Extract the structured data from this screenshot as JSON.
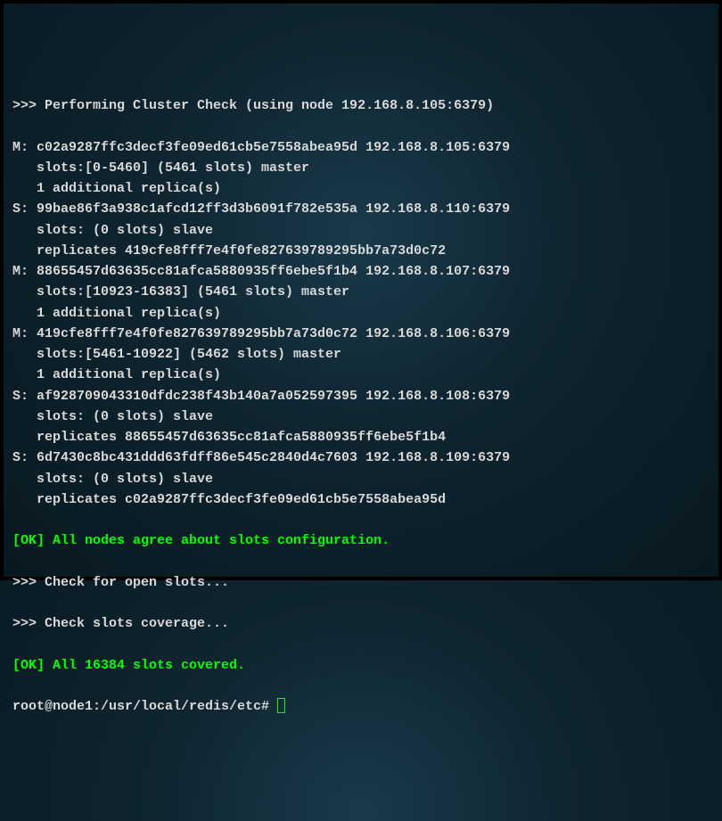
{
  "header": ">>> Performing Cluster Check (using node 192.168.8.105:6379)",
  "nodes": [
    {
      "role_prefix": "M: ",
      "id_addr": "c02a9287ffc3decf3fe09ed61cb5e7558abea95d 192.168.8.105:6379",
      "slots_line": "   slots:[0-5460] (5461 slots) master",
      "extra_line": "   1 additional replica(s)"
    },
    {
      "role_prefix": "S: ",
      "id_addr": "99bae86f3a938c1afcd12ff3d3b6091f782e535a 192.168.8.110:6379",
      "slots_line": "   slots: (0 slots) slave",
      "extra_line": "   replicates 419cfe8fff7e4f0fe827639789295bb7a73d0c72"
    },
    {
      "role_prefix": "M: ",
      "id_addr": "88655457d63635cc81afca5880935ff6ebe5f1b4 192.168.8.107:6379",
      "slots_line": "   slots:[10923-16383] (5461 slots) master",
      "extra_line": "   1 additional replica(s)"
    },
    {
      "role_prefix": "M: ",
      "id_addr": "419cfe8fff7e4f0fe827639789295bb7a73d0c72 192.168.8.106:6379",
      "slots_line": "   slots:[5461-10922] (5462 slots) master",
      "extra_line": "   1 additional replica(s)"
    },
    {
      "role_prefix": "S: ",
      "id_addr": "af928709043310dfdc238f43b140a7a052597395 192.168.8.108:6379",
      "slots_line": "   slots: (0 slots) slave",
      "extra_line": "   replicates 88655457d63635cc81afca5880935ff6ebe5f1b4"
    },
    {
      "role_prefix": "S: ",
      "id_addr": "6d7430c8bc431ddd63fdff86e545c2840d4c7603 192.168.8.109:6379",
      "slots_line": "   slots: (0 slots) slave",
      "extra_line": "   replicates c02a9287ffc3decf3fe09ed61cb5e7558abea95d"
    }
  ],
  "status1": "[OK] All nodes agree about slots configuration.",
  "check_open": ">>> Check for open slots...",
  "check_coverage": ">>> Check slots coverage...",
  "status2": "[OK] All 16384 slots covered.",
  "prompt": "root@node1:/usr/local/redis/etc# "
}
